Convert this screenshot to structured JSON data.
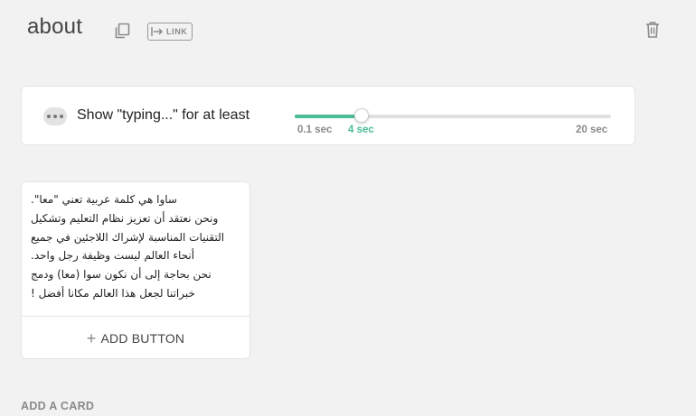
{
  "header": {
    "title": "about",
    "link_label": "LINK"
  },
  "typing": {
    "label": "Show \"typing...\" for at least",
    "min_label": "0.1 sec",
    "value_label": "4 sec",
    "max_label": "20 sec",
    "value_fraction": 0.21,
    "accent": "#4cbc96"
  },
  "card": {
    "text": "ساوا هي كلمة عربية تعني \"معا\".\nونحن نعتقد أن تعزيز نظام التعليم وتشكيل التقنيات المناسبة لإشراك اللاجئين في جميع أنحاء العالم ليست وظيفة رجل واحد.\nنحن بحاجة إلى أن نكون سوا (معا) ودمج خبراتنا لجعل هذا العالم مكانا أفضل !",
    "add_button_label": "ADD BUTTON"
  },
  "add_card_label": "ADD A CARD",
  "icons": {
    "copy": "copy-icon",
    "link": "link-icon",
    "delete": "trash-icon",
    "menu": "more-dots-icon",
    "add": "plus-icon"
  }
}
